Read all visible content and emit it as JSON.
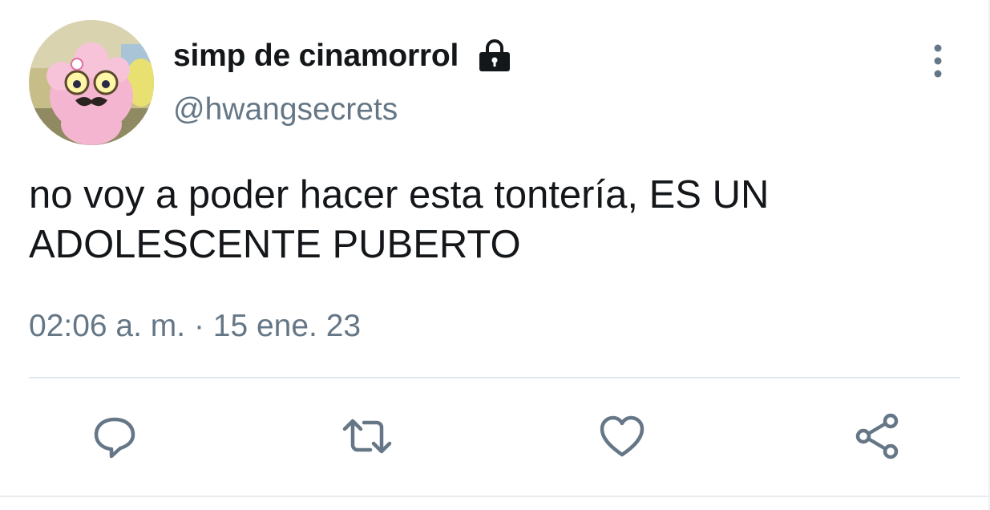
{
  "tweet": {
    "author": {
      "display_name": "simp de cinamorrol",
      "handle": "@hwangsecrets",
      "avatar_icon": "cartoon-character-avatar",
      "protected_icon": "lock-icon"
    },
    "text_lines": [
      "no voy a poder hacer esta tontería, ES UN",
      "ADOLESCENTE PUBERTO"
    ],
    "timestamp": "02:06 a. m. · 15 ene. 23",
    "actions": [
      {
        "name": "reply",
        "icon": "reply-icon"
      },
      {
        "name": "retweet",
        "icon": "retweet-icon"
      },
      {
        "name": "like",
        "icon": "heart-icon"
      },
      {
        "name": "share",
        "icon": "share-icon"
      }
    ],
    "more_icon": "more-vertical-icon"
  },
  "colors": {
    "primary_text": "#14171a",
    "secondary_text": "#657786",
    "divider": "#e1e8ed",
    "avatar_bg": "#c9c08a",
    "avatar_pink": "#f2a7c7"
  }
}
